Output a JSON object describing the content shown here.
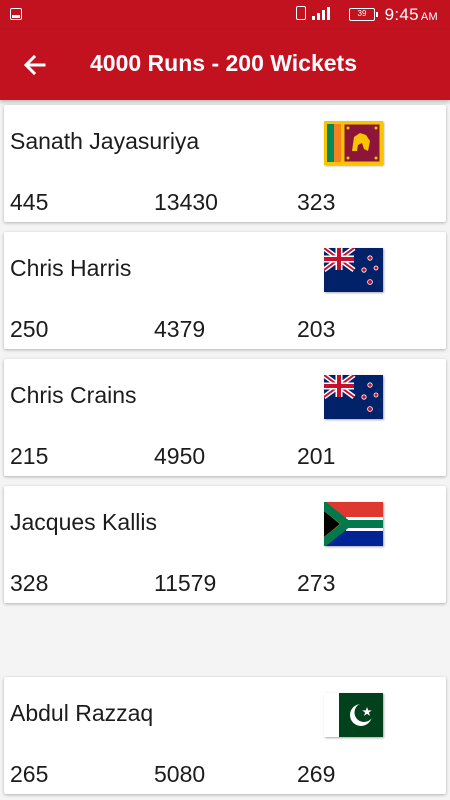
{
  "status_bar": {
    "time": "9:45",
    "ampm": "AM",
    "battery": "39"
  },
  "app_bar": {
    "title": "4000 Runs - 200 Wickets",
    "back_icon": "arrow-left-icon"
  },
  "colors": {
    "primary": "#c3121f",
    "background": "#f4f4f4",
    "card": "#ffffff"
  },
  "players": [
    {
      "name": "Sanath Jayasuriya",
      "country_flag": "sri-lanka-flag-icon",
      "stats": [
        "445",
        "13430",
        "323"
      ]
    },
    {
      "name": "Chris Harris",
      "country_flag": "new-zealand-flag-icon",
      "stats": [
        "250",
        "4379",
        "203"
      ]
    },
    {
      "name": "Chris Crains",
      "country_flag": "new-zealand-flag-icon",
      "stats": [
        "215",
        "4950",
        "201"
      ]
    },
    {
      "name": "Jacques Kallis",
      "country_flag": "south-africa-flag-icon",
      "stats": [
        "328",
        "11579",
        "273"
      ]
    },
    {
      "name": "Abdul Razzaq",
      "country_flag": "pakistan-flag-icon",
      "stats": [
        "265",
        "5080",
        "269"
      ]
    }
  ]
}
